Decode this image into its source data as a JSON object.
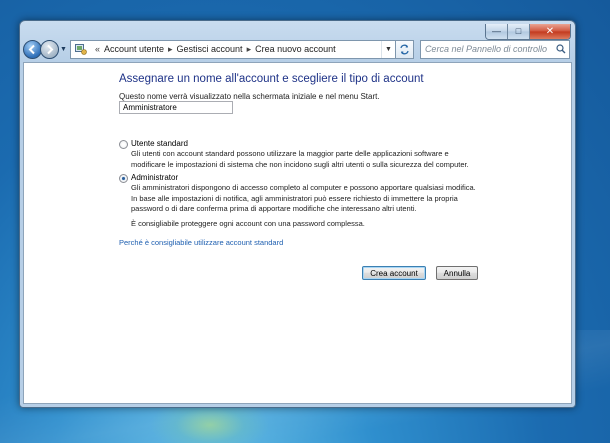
{
  "window": {
    "caption": {
      "minimize": "—",
      "maximize": "□",
      "close": "✕"
    }
  },
  "nav": {
    "back_icon": "arrow-left-icon",
    "forward_icon": "arrow-right-icon",
    "breadcrumb": [
      "Account utente",
      "Gestisci account",
      "Crea nuovo account"
    ],
    "overflow": "«",
    "search_placeholder": "Cerca nel Pannello di controllo"
  },
  "page": {
    "title": "Assegnare un nome all'account e scegliere il tipo di account",
    "name_prompt": "Questo nome verrà visualizzato nella schermata iniziale e nel menu Start.",
    "name_value": "Amministratore",
    "options": [
      {
        "label": "Utente standard",
        "selected": false,
        "desc": [
          "Gli utenti con account standard possono utilizzare la maggior parte delle applicazioni software e",
          "modificare le impostazioni di sistema che non incidono sugli altri utenti o sulla sicurezza del computer."
        ]
      },
      {
        "label": "Administrator",
        "selected": true,
        "desc": [
          "Gli amministratori dispongono di accesso completo al computer e possono apportare qualsiasi modifica.",
          "In base alle impostazioni di notifica, agli amministratori può essere richiesto di immettere la propria",
          "password o di dare conferma prima di apportare modifiche che interessano altri utenti."
        ]
      }
    ],
    "note": "È consigliabile proteggere ogni account con una password complessa.",
    "link": "Perché è consigliabile utilizzare account standard",
    "create_button": "Crea account",
    "cancel_button": "Annulla"
  },
  "colors": {
    "title": "#1e3287",
    "link": "#1e5fb0",
    "desktop": "#1b6bb0"
  }
}
